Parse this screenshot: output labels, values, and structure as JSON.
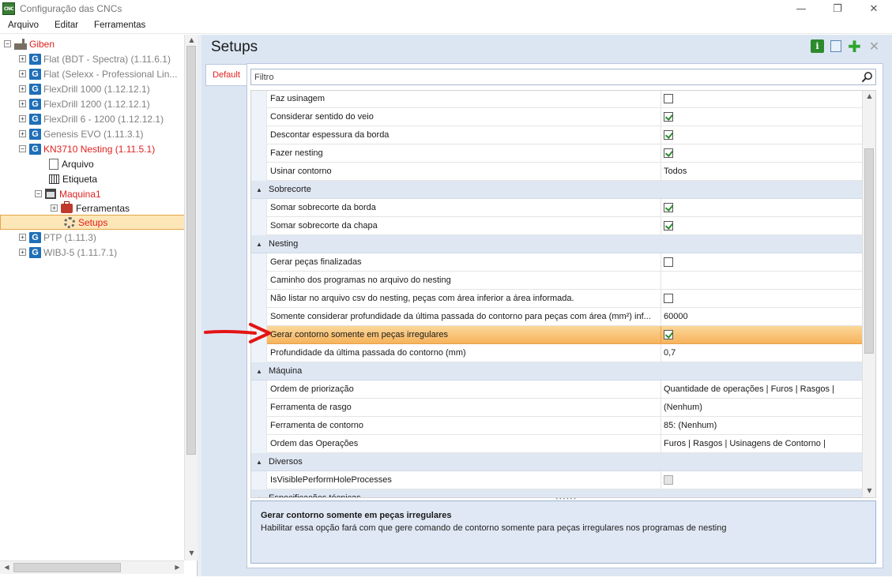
{
  "window": {
    "app_icon_text": "CNC",
    "title": "Configuração das CNCs",
    "controls": {
      "minimize": "—",
      "maximize": "❐",
      "close": "✕"
    }
  },
  "menu": [
    "Arquivo",
    "Editar",
    "Ferramentas"
  ],
  "tree": {
    "root": {
      "label": "Giben",
      "color": "#e02020"
    },
    "machines": [
      {
        "label": "Flat (BDT - Spectra) (1.11.6.1)",
        "state": "gray"
      },
      {
        "label": "Flat (Selexx - Professional Lin...",
        "state": "gray"
      },
      {
        "label": "FlexDrill 1000 (1.12.12.1)",
        "state": "gray"
      },
      {
        "label": "FlexDrill 1200 (1.12.12.1)",
        "state": "gray"
      },
      {
        "label": "FlexDrill 6 - 1200 (1.12.12.1)",
        "state": "gray"
      },
      {
        "label": "Genesis EVO (1.11.3.1)",
        "state": "gray"
      },
      {
        "label": "KN3710 Nesting (1.11.5.1)",
        "state": "red"
      }
    ],
    "kn_children": {
      "arquivo": "Arquivo",
      "etiqueta": "Etiqueta",
      "maquina": "Maquina1",
      "ferramentas": "Ferramentas",
      "setups": "Setups"
    },
    "more_machines": [
      {
        "label": "PTP (1.11.3)",
        "state": "gray"
      },
      {
        "label": "WIBJ-5 (1.11.7.1)",
        "state": "gray"
      }
    ],
    "expand_plus": "+",
    "expand_minus": "−"
  },
  "panel": {
    "title": "Setups",
    "tab_default": "Default",
    "filter_placeholder": "Filtro",
    "toolbar_icons": [
      "info-icon",
      "copy-icon",
      "add-icon",
      "close-icon"
    ]
  },
  "grid": {
    "rows": [
      {
        "type": "prop",
        "name": "Faz usinagem",
        "value_type": "checkbox",
        "checked": false
      },
      {
        "type": "prop",
        "name": "Considerar sentido do veio",
        "value_type": "checkbox",
        "checked": true
      },
      {
        "type": "prop",
        "name": "Descontar espessura da borda",
        "value_type": "checkbox",
        "checked": true
      },
      {
        "type": "prop",
        "name": "Fazer nesting",
        "value_type": "checkbox",
        "checked": true
      },
      {
        "type": "prop",
        "name": "Usinar contorno",
        "value_type": "text",
        "value": "Todos"
      },
      {
        "type": "category",
        "name": "Sobrecorte"
      },
      {
        "type": "prop",
        "name": "Somar sobrecorte da borda",
        "value_type": "checkbox",
        "checked": true
      },
      {
        "type": "prop",
        "name": "Somar sobrecorte da chapa",
        "value_type": "checkbox",
        "checked": true
      },
      {
        "type": "category",
        "name": "Nesting"
      },
      {
        "type": "prop",
        "name": "Gerar peças finalizadas",
        "value_type": "checkbox",
        "checked": false
      },
      {
        "type": "prop",
        "name": "Caminho dos programas no arquivo do nesting",
        "value_type": "text",
        "value": ""
      },
      {
        "type": "prop",
        "name": "Não listar no arquivo csv do nesting, peças com área inferior a área informada.",
        "value_type": "checkbox",
        "checked": false
      },
      {
        "type": "prop",
        "name": "Somente considerar profundidade da última passada do contorno para peças com área (mm²) inf...",
        "value_type": "text",
        "value": "60000"
      },
      {
        "type": "prop",
        "name": "Gerar contorno somente em peças irregulares",
        "value_type": "checkbox",
        "checked": true,
        "highlight": true
      },
      {
        "type": "prop",
        "name": "Profundidade da última passada do contorno (mm)",
        "value_type": "text",
        "value": "0,7"
      },
      {
        "type": "category",
        "name": "Máquina"
      },
      {
        "type": "prop",
        "name": "Ordem de priorização",
        "value_type": "text",
        "value": "Quantidade de operações | Furos | Rasgos |"
      },
      {
        "type": "prop",
        "name": "Ferramenta de rasgo",
        "value_type": "text",
        "value": "(Nenhum)"
      },
      {
        "type": "prop",
        "name": "Ferramenta de contorno",
        "value_type": "text",
        "value": "85: (Nenhum)"
      },
      {
        "type": "prop",
        "name": "Ordem das Operações",
        "value_type": "text",
        "value": "Furos | Rasgos | Usinagens de Contorno |"
      },
      {
        "type": "category",
        "name": "Diversos"
      },
      {
        "type": "prop",
        "name": "IsVisiblePerformHoleProcesses",
        "value_type": "checkbox",
        "checked": false,
        "disabled": true
      },
      {
        "type": "category",
        "name": "Especificações técnicas"
      }
    ]
  },
  "description": {
    "title": "Gerar contorno somente em peças irregulares",
    "text": "Habilitar essa opção fará com que gere comando de contorno somente para peças irregulares nos programas de nesting"
  },
  "colors": {
    "accent_red": "#e02020",
    "highlight": "#f6b35c",
    "category_bg": "#dfe7f3",
    "panel_bg": "#dce6f3"
  }
}
